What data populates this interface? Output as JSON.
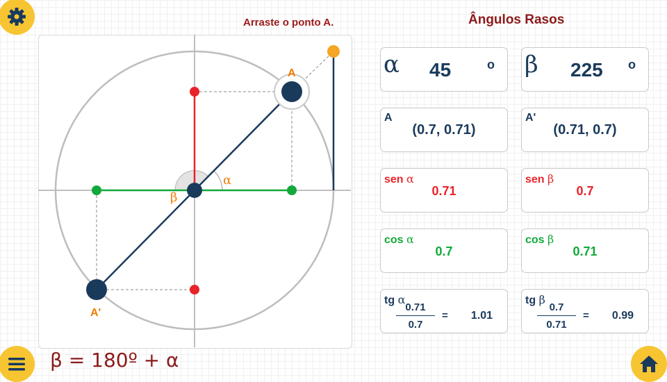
{
  "instruction": "Arraste o ponto A.",
  "panel_title": "Ângulos Rasos",
  "formula": "β = 180º +  α",
  "plot": {
    "point_a_label": "A",
    "point_a_prime_label": "A'",
    "alpha_label": "α",
    "beta_label": "β"
  },
  "cards": {
    "alpha": {
      "symbol": "α",
      "value": "45",
      "unit": "o"
    },
    "beta": {
      "symbol": "β",
      "value": "225",
      "unit": "o"
    },
    "point_a": {
      "label": "A",
      "value": "(0.7, 0.71)"
    },
    "point_a_prime": {
      "label": "A'",
      "value": "(0.71, 0.7)"
    },
    "sen_alpha": {
      "word": "sen",
      "symbol": "α",
      "value": "0.71"
    },
    "sen_beta": {
      "word": "sen",
      "symbol": "β",
      "value": "0.7"
    },
    "cos_alpha": {
      "word": "cos",
      "symbol": "α",
      "value": "0.7"
    },
    "cos_beta": {
      "word": "cos",
      "symbol": "β",
      "value": "0.71"
    },
    "tg_alpha": {
      "word": "tg",
      "symbol": "α",
      "numerator": "0.71",
      "denominator": "0.7",
      "equals": "=",
      "value": "1.01"
    },
    "tg_beta": {
      "word": "tg",
      "symbol": "β",
      "numerator": "0.7",
      "denominator": "0.71",
      "equals": "=",
      "value": "0.99"
    }
  },
  "colors": {
    "accent": "#f7c531",
    "navy": "#1a3a5c",
    "sine": "#e8232a",
    "cosine": "#12a83a",
    "tangent_point": "#f5a623",
    "title": "#8b1a1a"
  },
  "icons": {
    "settings": "gear-icon",
    "menu": "hamburger-icon",
    "home": "home-icon"
  }
}
